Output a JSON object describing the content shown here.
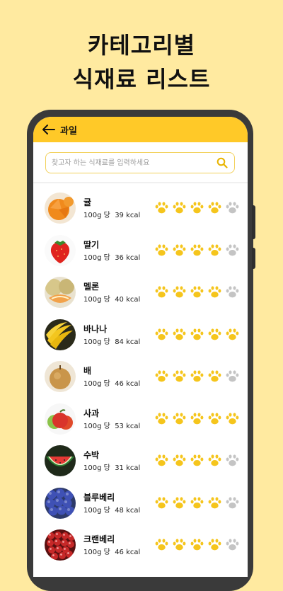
{
  "headline": {
    "line1": "카테고리별",
    "line2": "식재료 리스트"
  },
  "appbar": {
    "title": "과일"
  },
  "search": {
    "placeholder": "찾고자 하는 식재료를 입력하세요"
  },
  "colors": {
    "paw_on": "#F5C51C",
    "paw_off": "#C4C4C4",
    "accent": "#FFC928"
  },
  "items": [
    {
      "name": "귤",
      "unit": "100g 당",
      "kcal": "39 kcal",
      "rating": 4,
      "fruit": "mandarin"
    },
    {
      "name": "딸기",
      "unit": "100g 당",
      "kcal": "36 kcal",
      "rating": 4,
      "fruit": "strawberry"
    },
    {
      "name": "멜론",
      "unit": "100g 당",
      "kcal": "40 kcal",
      "rating": 4,
      "fruit": "melon"
    },
    {
      "name": "바나나",
      "unit": "100g 당",
      "kcal": "84 kcal",
      "rating": 5,
      "fruit": "banana"
    },
    {
      "name": "배",
      "unit": "100g 당",
      "kcal": "46 kcal",
      "rating": 4,
      "fruit": "pear"
    },
    {
      "name": "사과",
      "unit": "100g 당",
      "kcal": "53 kcal",
      "rating": 5,
      "fruit": "apple"
    },
    {
      "name": "수박",
      "unit": "100g 당",
      "kcal": "31 kcal",
      "rating": 4,
      "fruit": "watermelon"
    },
    {
      "name": "블루베리",
      "unit": "100g 당",
      "kcal": "48 kcal",
      "rating": 4,
      "fruit": "blueberry"
    },
    {
      "name": "크랜베리",
      "unit": "100g 당",
      "kcal": "46 kcal",
      "rating": 4,
      "fruit": "cranberry"
    }
  ]
}
